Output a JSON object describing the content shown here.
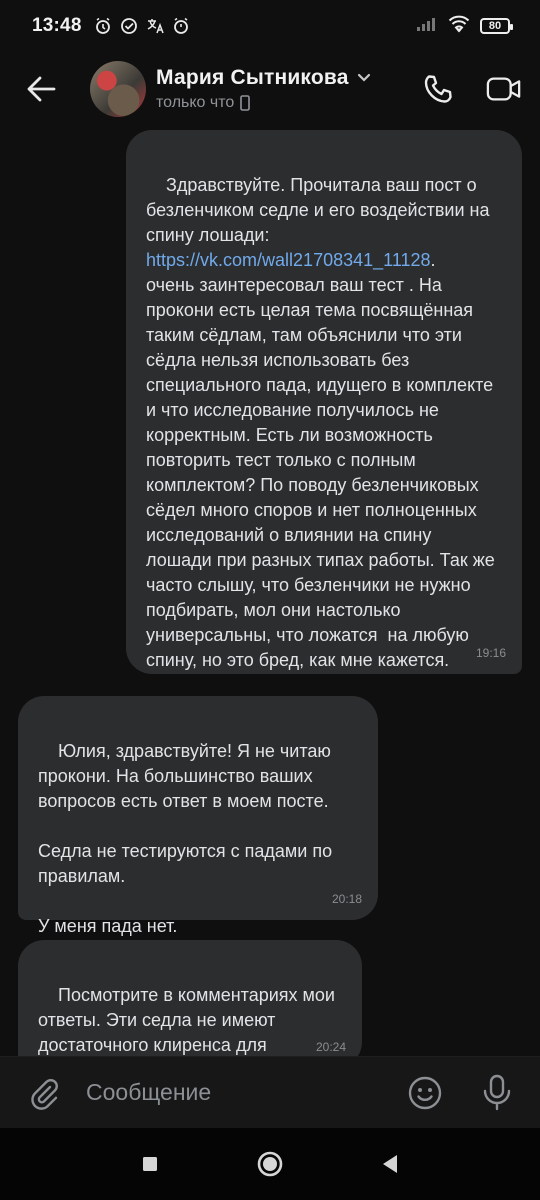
{
  "status_bar": {
    "time": "13:48",
    "battery": "80"
  },
  "header": {
    "name": "Мария Сытникова",
    "status": "только что"
  },
  "messages": [
    {
      "direction": "out",
      "parts": {
        "before": "Здравствуйте. Прочитала ваш пост о безленчиком седле и его воздействии на спину лошади:\n",
        "link": "https://vk.com/wall21708341_11128",
        "after": ".\nочень заинтересовал ваш тест . На прокони есть целая тема посвящённая таким сёдлам, там объяснили что эти сёдла нельзя использовать без специального пада, идущего в комплекте и что исследование получилось не корректным. Есть ли возможность повторить тест только с полным комплектом? По поводу безленчиковых сёдел много споров и нет полноценных исследований о влиянии на спину лошади при разных типах работы. Так же часто слышу, что безленчики не нужно подбирать, мол они настолько универсальны, что ложатся  на любую спину, но это бред, как мне кажется."
      },
      "time": "19:16"
    },
    {
      "direction": "in",
      "text": "Юлия, здравствуйте! Я не читаю прокони. На большинство ваших вопросов есть ответ в моем посте.\n\nСедла не тестируются с падами по правилам.\n\nУ меня пада нет.",
      "time": "20:18"
    },
    {
      "direction": "in",
      "text": "Посмотрите в комментариях мои ответы. Эти седла не имеют достаточного клиренса для позвоночника.",
      "time": "20:24"
    }
  ],
  "composer": {
    "placeholder": "Сообщение"
  },
  "icons": {
    "back": "arrow-left-icon",
    "call": "phone-icon",
    "video": "video-camera-icon",
    "attach": "paperclip-icon",
    "emoji": "smile-icon",
    "mic": "microphone-icon",
    "chevron": "chevron-down-icon",
    "device": "phone-device-icon"
  },
  "colors": {
    "bubble": "#2c2d2e",
    "link": "#71aaeb",
    "background": "#0f0f0f"
  }
}
